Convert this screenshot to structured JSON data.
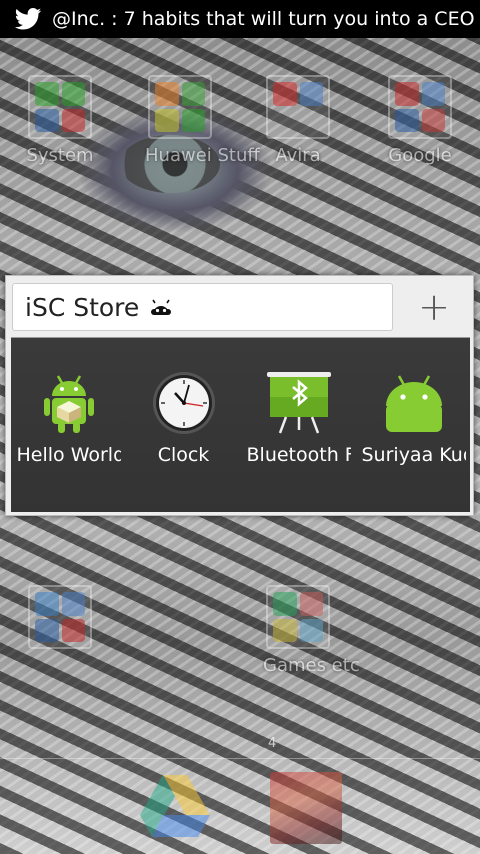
{
  "status_bar": {
    "notification_icon": "twitter-icon",
    "ticker_text": "@Inc. : 7 habits that will turn you into a CEO"
  },
  "home_folders": [
    {
      "label": "System"
    },
    {
      "label": "Huawei Stuff"
    },
    {
      "label": "Avira"
    },
    {
      "label": "Google"
    },
    {
      "label": "Games etc"
    }
  ],
  "folder_popup": {
    "name": "iSC Store",
    "add_icon": "plus-icon",
    "apps": [
      {
        "label": "Hello World",
        "icon": "android-box-icon"
      },
      {
        "label": "Clock",
        "icon": "clock-icon"
      },
      {
        "label": "Bluetooth File Transfer",
        "icon": "bluetooth-icon"
      },
      {
        "label": "Suriyaa Kudo",
        "icon": "android-icon"
      }
    ]
  },
  "page_indicator": "4",
  "dock": {
    "items": [
      "google-drive-icon",
      "photo-icon"
    ]
  }
}
